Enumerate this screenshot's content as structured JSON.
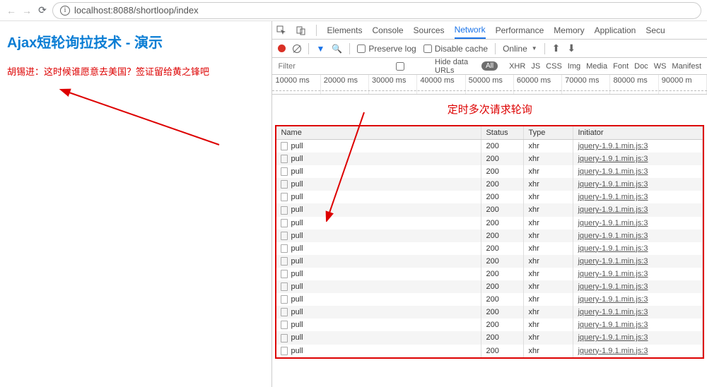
{
  "browser": {
    "url": "localhost:8088/shortloop/index"
  },
  "page": {
    "title": "Ajax短轮询拉技术 - 演示",
    "message": "胡锡进：这时候谁愿意去美国？签证留给黄之锋吧"
  },
  "devtools": {
    "tabs": [
      "Elements",
      "Console",
      "Sources",
      "Network",
      "Performance",
      "Memory",
      "Application",
      "Secu"
    ],
    "active_tab": "Network",
    "toolbar": {
      "preserve_log": "Preserve log",
      "disable_cache": "Disable cache",
      "online": "Online"
    },
    "filter": {
      "placeholder": "Filter",
      "hide_data_urls": "Hide data URLs",
      "all": "All",
      "types": [
        "XHR",
        "JS",
        "CSS",
        "Img",
        "Media",
        "Font",
        "Doc",
        "WS",
        "Manifest"
      ]
    },
    "timeline": [
      "10000 ms",
      "20000 ms",
      "30000 ms",
      "40000 ms",
      "50000 ms",
      "60000 ms",
      "70000 ms",
      "80000 ms",
      "90000 m"
    ],
    "annotation": "定时多次请求轮询",
    "columns": {
      "name": "Name",
      "status": "Status",
      "type": "Type",
      "initiator": "Initiator"
    },
    "rows": [
      {
        "name": "pull",
        "status": "200",
        "type": "xhr",
        "initiator": "jquery-1.9.1.min.js:3"
      },
      {
        "name": "pull",
        "status": "200",
        "type": "xhr",
        "initiator": "jquery-1.9.1.min.js:3"
      },
      {
        "name": "pull",
        "status": "200",
        "type": "xhr",
        "initiator": "jquery-1.9.1.min.js:3"
      },
      {
        "name": "pull",
        "status": "200",
        "type": "xhr",
        "initiator": "jquery-1.9.1.min.js:3"
      },
      {
        "name": "pull",
        "status": "200",
        "type": "xhr",
        "initiator": "jquery-1.9.1.min.js:3"
      },
      {
        "name": "pull",
        "status": "200",
        "type": "xhr",
        "initiator": "jquery-1.9.1.min.js:3"
      },
      {
        "name": "pull",
        "status": "200",
        "type": "xhr",
        "initiator": "jquery-1.9.1.min.js:3"
      },
      {
        "name": "pull",
        "status": "200",
        "type": "xhr",
        "initiator": "jquery-1.9.1.min.js:3"
      },
      {
        "name": "pull",
        "status": "200",
        "type": "xhr",
        "initiator": "jquery-1.9.1.min.js:3"
      },
      {
        "name": "pull",
        "status": "200",
        "type": "xhr",
        "initiator": "jquery-1.9.1.min.js:3"
      },
      {
        "name": "pull",
        "status": "200",
        "type": "xhr",
        "initiator": "jquery-1.9.1.min.js:3"
      },
      {
        "name": "pull",
        "status": "200",
        "type": "xhr",
        "initiator": "jquery-1.9.1.min.js:3"
      },
      {
        "name": "pull",
        "status": "200",
        "type": "xhr",
        "initiator": "jquery-1.9.1.min.js:3"
      },
      {
        "name": "pull",
        "status": "200",
        "type": "xhr",
        "initiator": "jquery-1.9.1.min.js:3"
      },
      {
        "name": "pull",
        "status": "200",
        "type": "xhr",
        "initiator": "jquery-1.9.1.min.js:3"
      },
      {
        "name": "pull",
        "status": "200",
        "type": "xhr",
        "initiator": "jquery-1.9.1.min.js:3"
      },
      {
        "name": "pull",
        "status": "200",
        "type": "xhr",
        "initiator": "jquery-1.9.1.min.js:3"
      }
    ]
  }
}
